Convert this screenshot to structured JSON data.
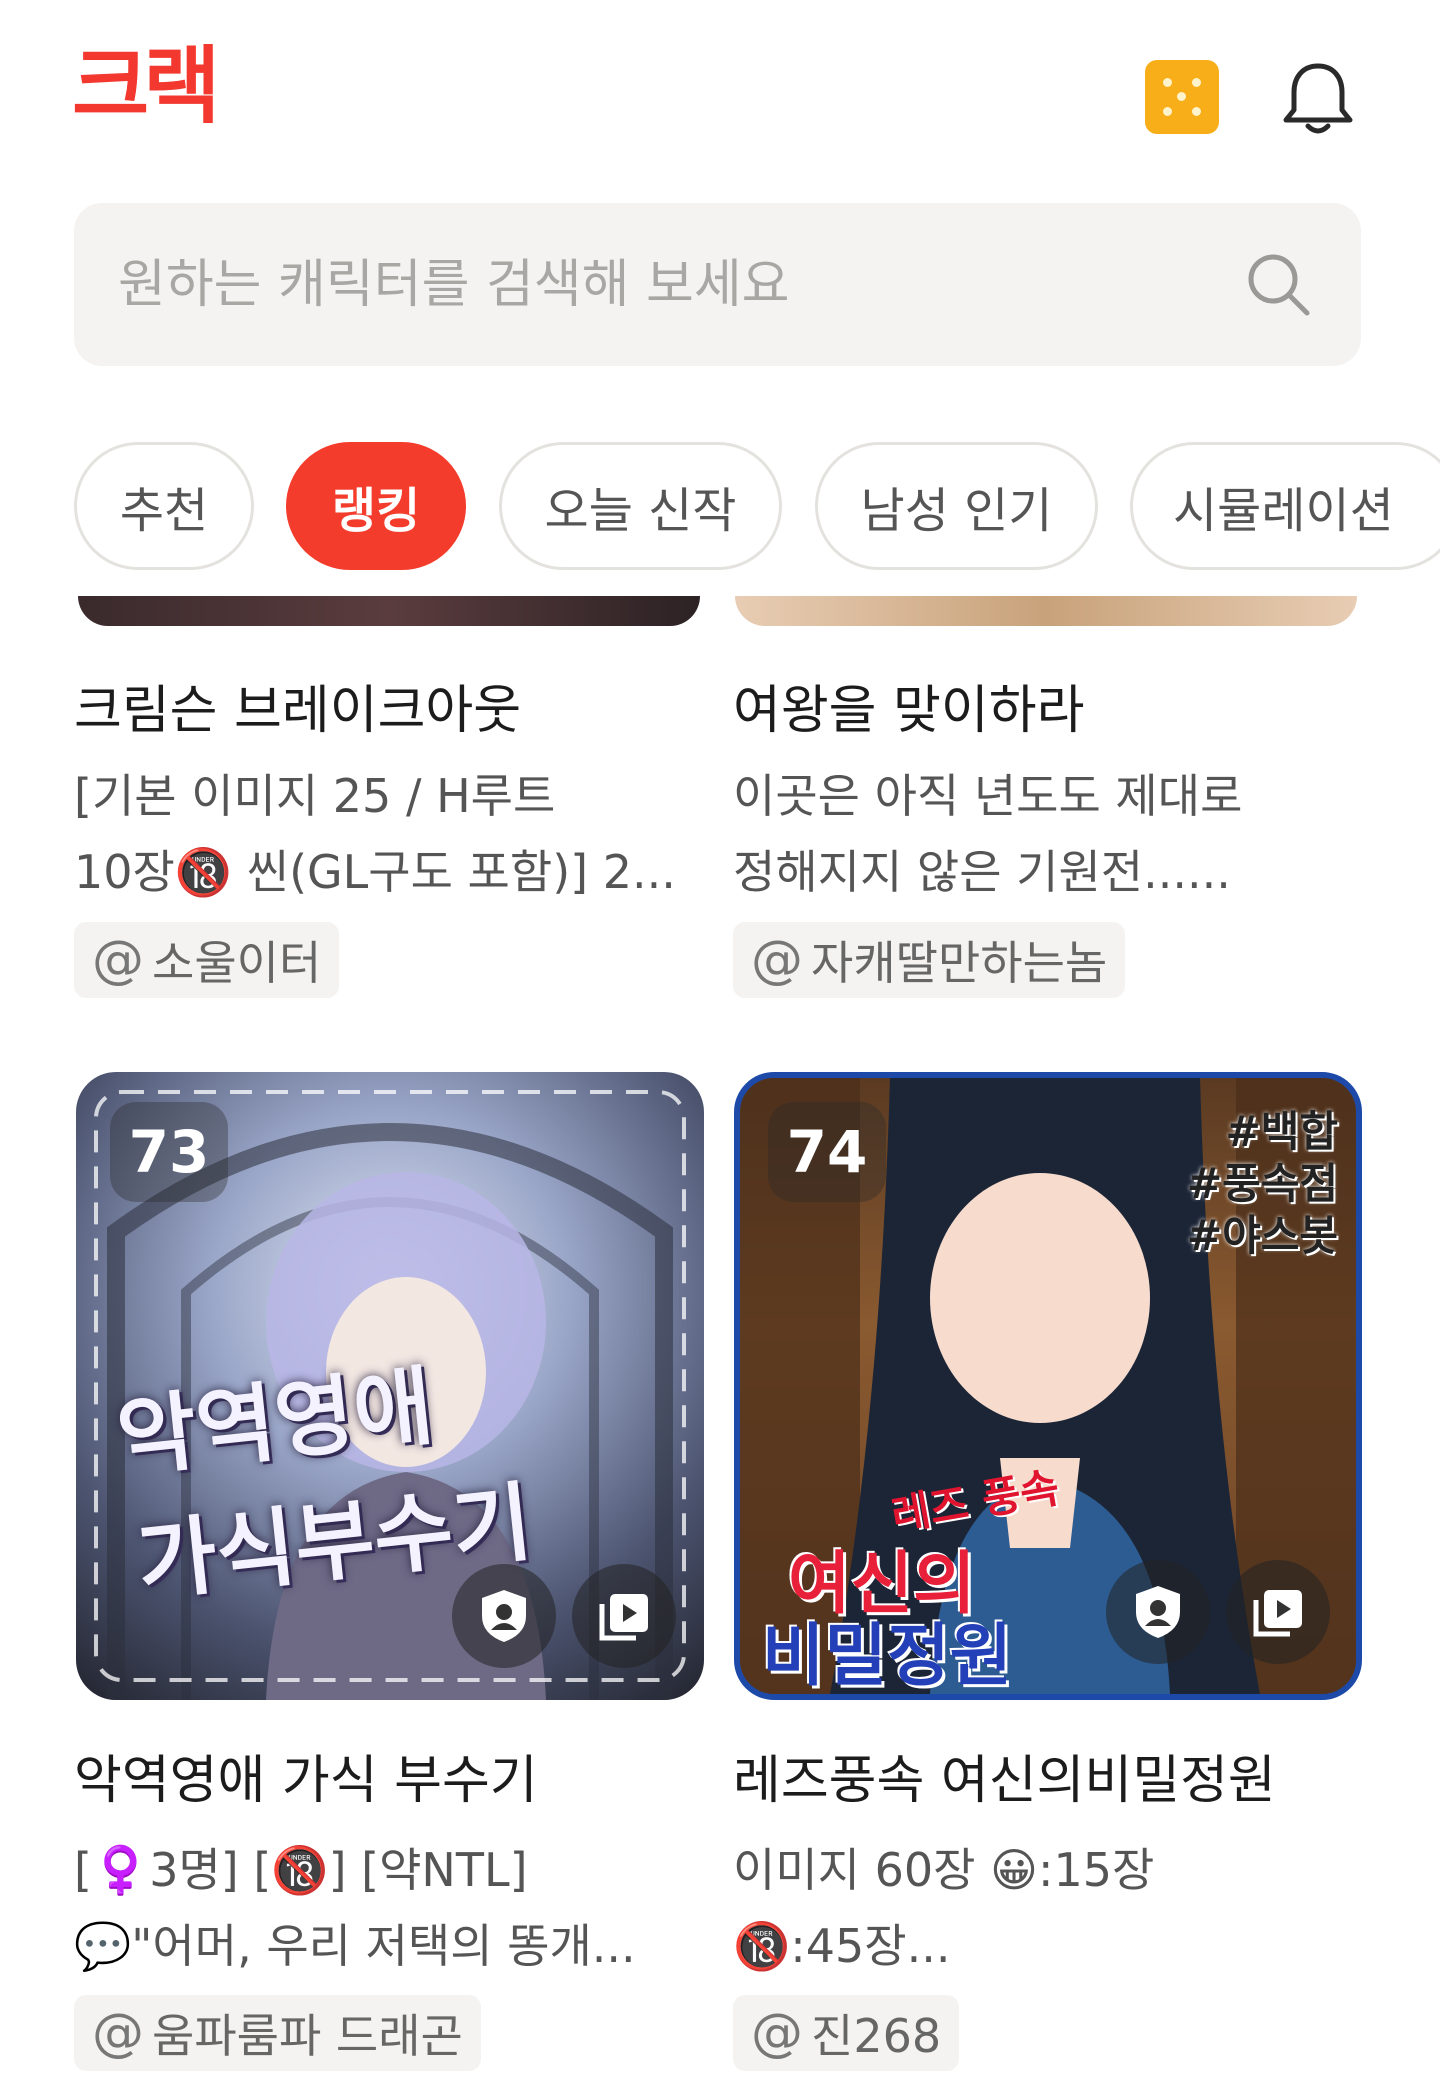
{
  "header": {
    "logo": "크랙",
    "coin_icon": "cookie-coin-icon",
    "bell_icon": "bell-icon"
  },
  "search": {
    "placeholder": "원하는 캐릭터를 검색해 보세요",
    "icon": "search-icon"
  },
  "tabs": [
    {
      "label": "추천",
      "active": false
    },
    {
      "label": "랭킹",
      "active": true
    },
    {
      "label": "오늘 신작",
      "active": false
    },
    {
      "label": "남성 인기",
      "active": false
    },
    {
      "label": "시뮬레이션",
      "active": false
    }
  ],
  "colors": {
    "brand": "#f2382f",
    "active_tab": "#f43c2c",
    "coin": "#f8ae18",
    "chip_bg": "#f4f3f1"
  },
  "cards": [
    {
      "title": "크림슨 브레이크아웃",
      "desc_lines": [
        "[기본 이미지 25 / H루트",
        "10장🔞 씬(GL구도 포함)] 2..."
      ],
      "author": "소울이터"
    },
    {
      "title": "여왕을 맞이하라",
      "desc_lines": [
        "이곳은 아직 년도도 제대로",
        "정해지지 않은 기원전......"
      ],
      "author": "자캐딸만하는놈"
    },
    {
      "rank": "73",
      "art_title_1": "악역영애",
      "art_title_2": "가식부수기",
      "title": "악역영애 가식 부수기",
      "desc_lines": [
        "[♀️3명] [🔞] [약NTL]",
        "💬\"어머, 우리 저택의 똥개..."
      ],
      "author": "움파룸파 드래곤"
    },
    {
      "rank": "74",
      "art_tags": [
        "#백합",
        "#풍속점",
        "#야스봇"
      ],
      "art_title_1": "레즈 풍속",
      "art_title_2": "여신의",
      "art_title_3": "비밀정원",
      "title": "레즈풍속 여신의비밀정원",
      "desc_lines": [
        "이미지 60장 😀:15장",
        "🔞:45장..."
      ],
      "author": "진268"
    }
  ],
  "thumb_buttons": {
    "profile_icon": "profile-shield-icon",
    "gallery_icon": "gallery-play-icon"
  }
}
